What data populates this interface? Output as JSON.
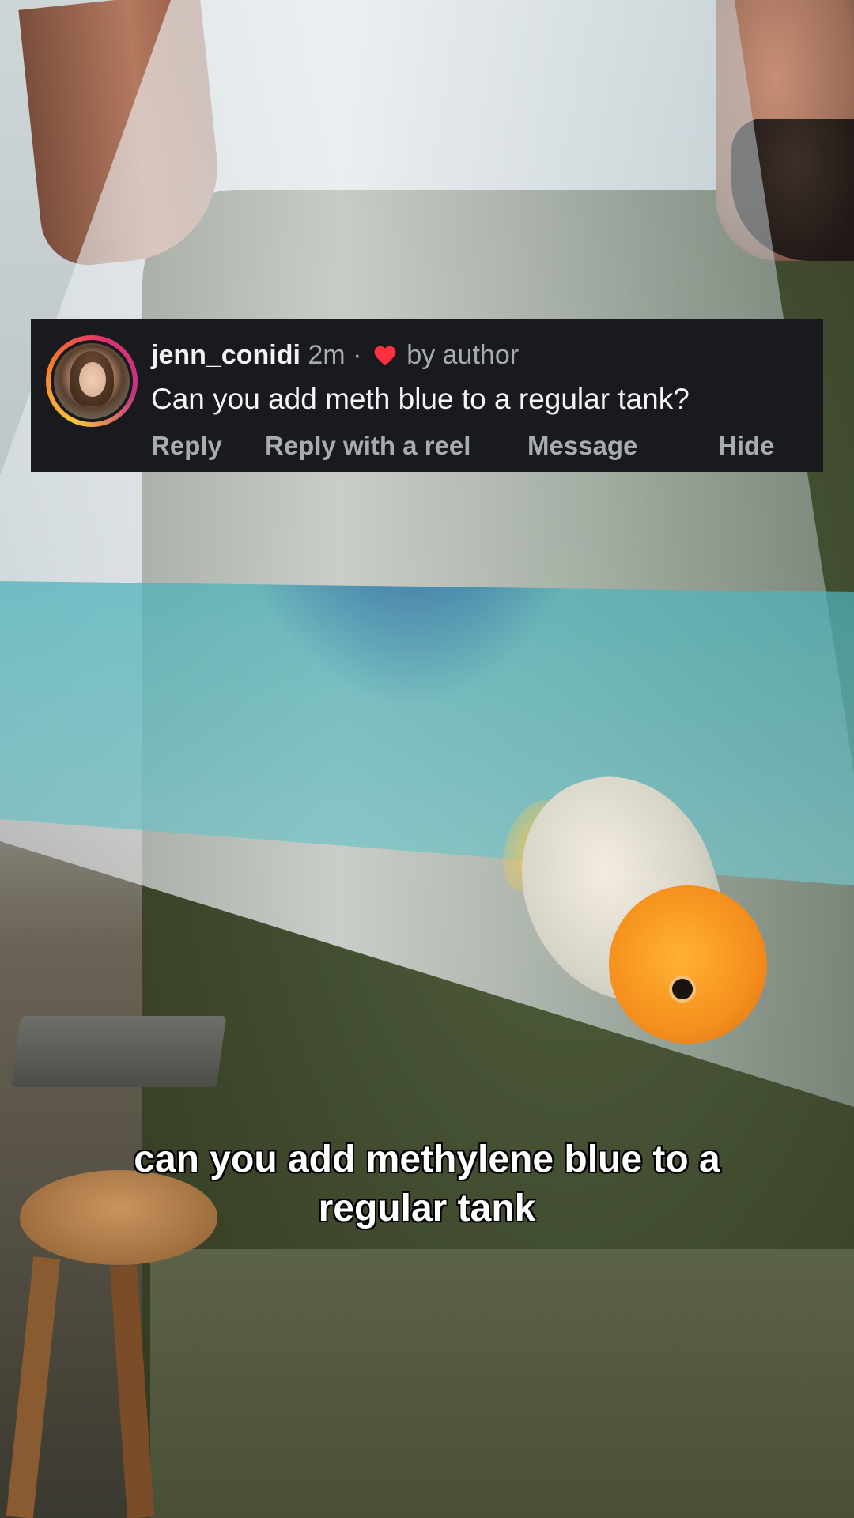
{
  "comment": {
    "username": "jenn_conidi",
    "time": "2m",
    "separator": "·",
    "liked_by": "by author",
    "text": "Can you add meth blue to a regular tank?",
    "actions": {
      "reply": "Reply",
      "reply_with_reel": "Reply with a reel",
      "message": "Message",
      "hide": "Hide"
    },
    "heart_color": "#ff3040",
    "avatar_ring_colors": [
      "#f9c43a",
      "#f77c2b",
      "#e1306c",
      "#c13584"
    ]
  },
  "caption": {
    "line1": "can you add methylene blue to a",
    "line2": "regular tank"
  }
}
